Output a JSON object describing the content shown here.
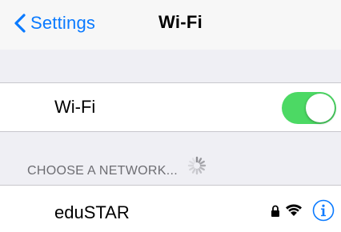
{
  "navbar": {
    "back_label": "Settings",
    "title": "Wi-Fi"
  },
  "wifi_toggle": {
    "label": "Wi-Fi",
    "on": true
  },
  "network_section": {
    "header": "CHOOSE A NETWORK..."
  },
  "networks": [
    {
      "name": "eduSTAR",
      "secured": true,
      "icons": [
        "lock-icon",
        "wifi-signal-icon",
        "info-icon"
      ]
    }
  ],
  "colors": {
    "accent": "#0a7aff",
    "toggle_on": "#4cd964",
    "group_background": "#efeff4",
    "navbar_background": "#f7f7f7",
    "section_text": "#6d6d72"
  }
}
